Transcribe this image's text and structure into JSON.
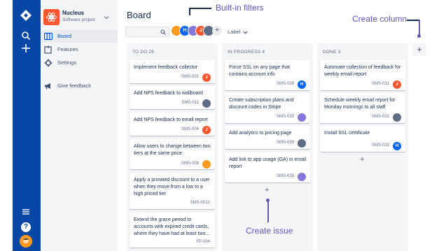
{
  "project": {
    "name": "Nucleus",
    "type": "Software project"
  },
  "sidebar": {
    "items": [
      {
        "label": "Board"
      },
      {
        "label": "Features"
      },
      {
        "label": "Settings"
      },
      {
        "label": "Give feedback"
      }
    ]
  },
  "global_nav": {
    "help_label": "?"
  },
  "board": {
    "title": "Board",
    "label_filter": "Label",
    "add_avatar_label": "+",
    "avatars": [
      {
        "initial": "",
        "color": "#ff991f"
      },
      {
        "initial": "H",
        "color": "#0065ff"
      },
      {
        "initial": "",
        "color": "#8777d9"
      },
      {
        "initial": "J",
        "color": "#ff5630"
      },
      {
        "initial": "",
        "color": "#5e6c84"
      }
    ],
    "add_column_label": "+",
    "columns": [
      {
        "header": "TO DO  29",
        "cards": [
          {
            "text": "Implement feedback collector",
            "key": "SMS-001",
            "avatar": "J",
            "avatar_color": "#ff5630"
          },
          {
            "text": "Add NPS feedback to wallboard",
            "key": "SMS-011",
            "avatar": "",
            "avatar_color": "#5e6c84"
          },
          {
            "text": "Add NPS feedback to email report",
            "key": "SMS-004",
            "avatar": "J",
            "avatar_color": "#ff5630"
          },
          {
            "text": "Allow users to change between two tiers at the same price",
            "key": "SMS-008",
            "avatar": "",
            "avatar_color": "#ff991f"
          },
          {
            "text": "Apply a prorated discount to a user when they move from a low to a high priced tier",
            "key": "SMS-0012",
            "avatar": null,
            "avatar_color": null
          },
          {
            "text": "Extend the grace period to accounts with expired credit cards, where they have had at least two...",
            "key": "FP-004",
            "avatar": null,
            "avatar_color": null
          }
        ]
      },
      {
        "header": "IN PROGRESS  4",
        "add_issue_label": "+",
        "cards": [
          {
            "text": "Force SSL on any page that contains account info",
            "key": "SMS-029",
            "avatar": "H",
            "avatar_color": "#0065ff"
          },
          {
            "text": "Create subscription plans and discount codes in Stripe",
            "key": "SMS-035",
            "avatar": "",
            "avatar_color": "#8777d9"
          },
          {
            "text": "Add analytics to pricing page",
            "key": "SMS-039",
            "avatar": "",
            "avatar_color": "#5e6c84"
          },
          {
            "text": "Add link to app usage (GA) in email report",
            "key": "SMS-035",
            "avatar": "",
            "avatar_color": "#8777d9"
          }
        ]
      },
      {
        "header": "DONE  3",
        "add_issue_label": "+",
        "cards": [
          {
            "text": "Automate collection of feedback for weekly email report",
            "key": "SMS-031",
            "avatar": "J",
            "avatar_color": "#ff5630"
          },
          {
            "text": "Schedule weekly email report for Monday mornings to all staff",
            "key": "SMS-032",
            "avatar": "",
            "avatar_color": "#5e6c84"
          },
          {
            "text": "Install SSL certificate",
            "key": "SMS-033",
            "avatar": "H",
            "avatar_color": "#0065ff"
          }
        ]
      }
    ]
  },
  "annotations": {
    "builtin_filters": "Built-in filters",
    "create_column": "Create column",
    "create_issue": "Create issue"
  },
  "colors": {
    "nav": "#0747a6",
    "accent": "#0052cc",
    "annotation": "#6554c0"
  }
}
